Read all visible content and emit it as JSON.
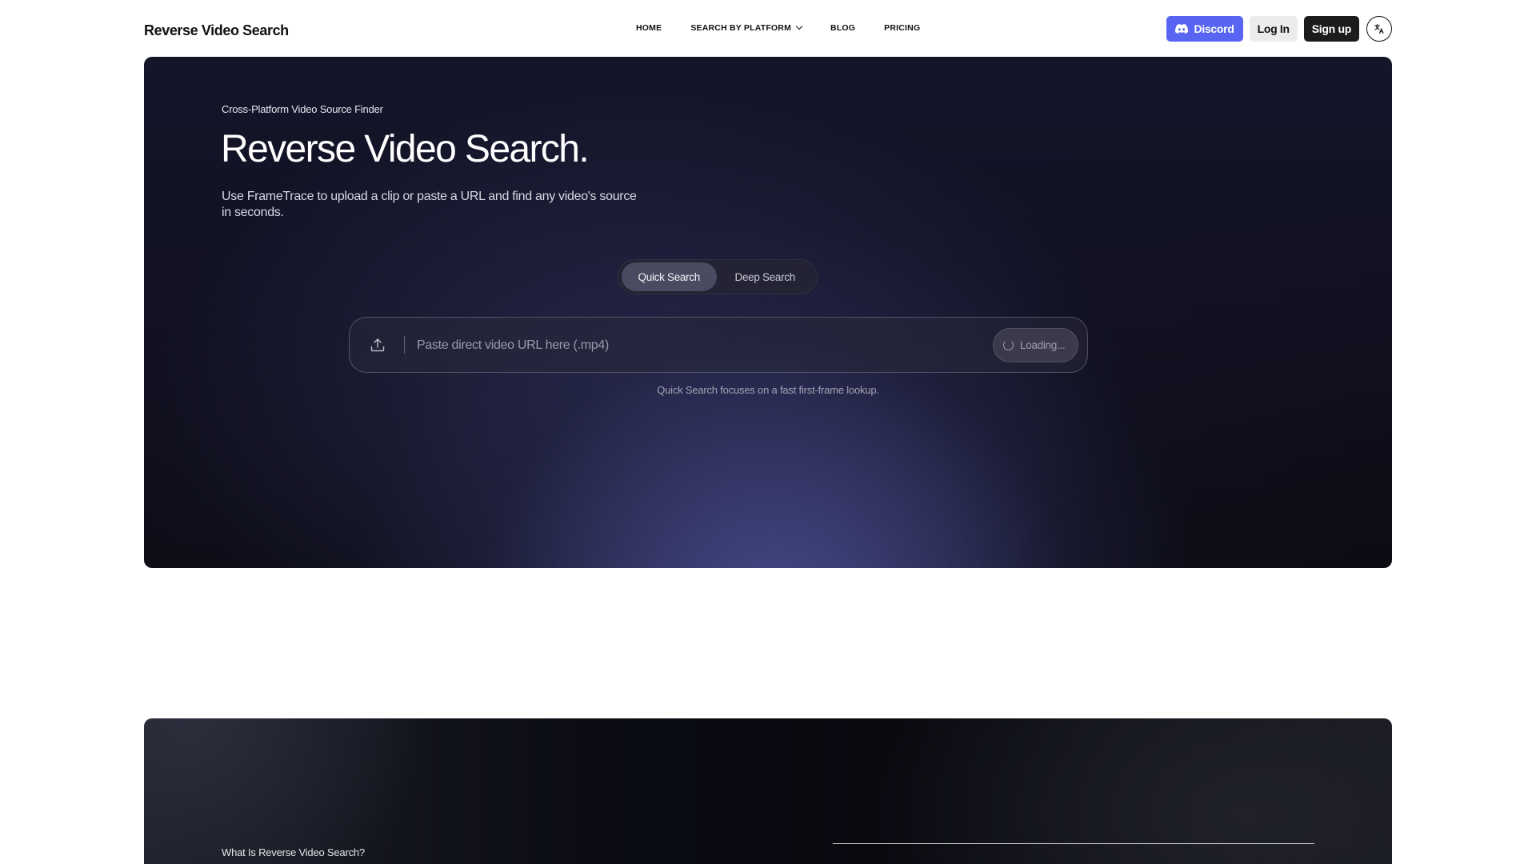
{
  "header": {
    "brand": "Reverse Video Search",
    "nav": [
      {
        "label": "HOME"
      },
      {
        "label": "SEARCH BY PLATFORM",
        "has_dropdown": true
      },
      {
        "label": "BLOG"
      },
      {
        "label": "PRICING"
      }
    ],
    "discord_label": "Discord",
    "login_label": "Log In",
    "signup_label": "Sign up",
    "lang_icon": "translate-icon",
    "discord_color": "#5865f2"
  },
  "hero": {
    "kicker": "Cross-Platform Video Source Finder",
    "title": "Reverse Video Search.",
    "description": "Use FrameTrace to upload a clip or paste a URL and find any video's source in seconds.",
    "modes": [
      {
        "label": "Quick Search",
        "active": true
      },
      {
        "label": "Deep Search",
        "active": false
      }
    ],
    "search": {
      "placeholder": "Paste direct video URL here (.mp4)",
      "value": "",
      "submit_label": "Loading..."
    },
    "hint": "Quick Search focuses on a fast first-frame lookup."
  },
  "section2": {
    "title": "What Is Reverse Video Search?"
  }
}
